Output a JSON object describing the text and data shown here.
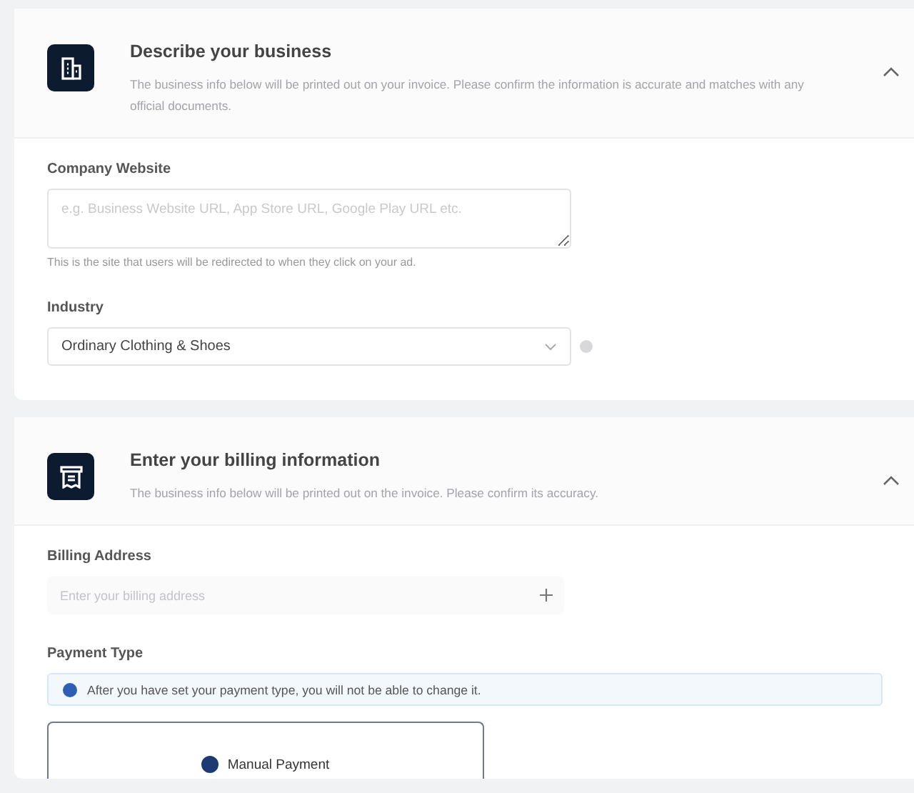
{
  "sections": [
    {
      "title": "Describe your business",
      "description": "The business info below will be printed out on your invoice. Please confirm the information is accurate and matches with any official documents.",
      "expanded": true,
      "fields": [
        {
          "kind": "textarea",
          "label": "Company Website",
          "placeholder": "e.g. Business Website URL, App Store URL, Google Play URL etc.",
          "help": "This is the site that users will be redirected to when they click on your ad."
        },
        {
          "kind": "select",
          "label": "Industry",
          "value": "Ordinary Clothing & Shoes"
        }
      ]
    },
    {
      "title": "Enter your billing information",
      "description": "The business info below will be printed out on the invoice. Please confirm its accuracy.",
      "expanded": true,
      "fields": [
        {
          "kind": "address",
          "label": "Billing Address",
          "placeholder": "Enter your billing address"
        },
        {
          "kind": "payment",
          "label": "Payment Type",
          "notice": "After you have set your payment type, you will not be able to change it.",
          "options": [
            {
              "label": "Manual Payment",
              "selected": true
            }
          ]
        }
      ]
    }
  ]
}
